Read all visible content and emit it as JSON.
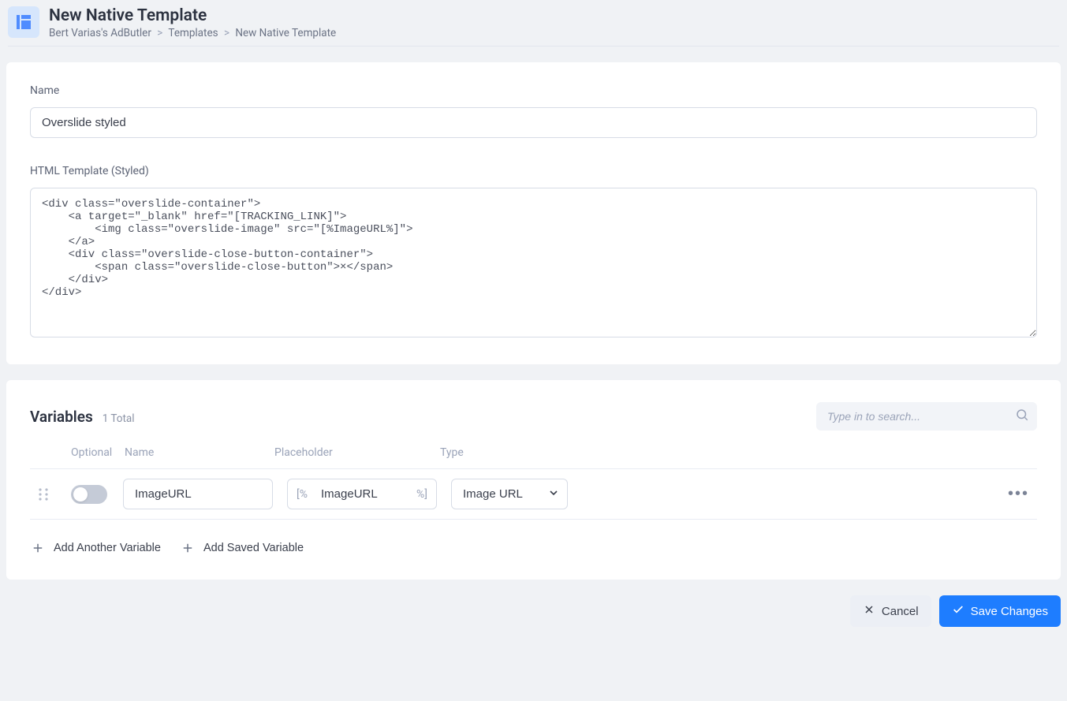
{
  "header": {
    "title": "New Native Template",
    "breadcrumb": {
      "root": "Bert Varias's AdButler",
      "mid": "Templates",
      "current": "New Native Template"
    }
  },
  "form": {
    "name_label": "Name",
    "name_value": "Overslide styled",
    "html_label": "HTML Template (Styled)",
    "html_value": "<div class=\"overslide-container\">\n    <a target=\"_blank\" href=\"[TRACKING_LINK]\">\n        <img class=\"overslide-image\" src=\"[%ImageURL%]\">\n    </a>\n    <div class=\"overslide-close-button-container\">\n        <span class=\"overslide-close-button\">×</span>\n    </div>\n</div>"
  },
  "variables": {
    "title": "Variables",
    "count_text": "1 Total",
    "search_placeholder": "Type in to search...",
    "columns": {
      "optional": "Optional",
      "name": "Name",
      "placeholder": "Placeholder",
      "type": "Type"
    },
    "rows": [
      {
        "optional": false,
        "name": "ImageURL",
        "placeholder": "ImageURL",
        "placeholder_prefix": "[%",
        "placeholder_suffix": "%]",
        "type": "Image URL"
      }
    ],
    "add_another": "Add Another Variable",
    "add_saved": "Add Saved Variable"
  },
  "footer": {
    "cancel": "Cancel",
    "save": "Save Changes"
  }
}
